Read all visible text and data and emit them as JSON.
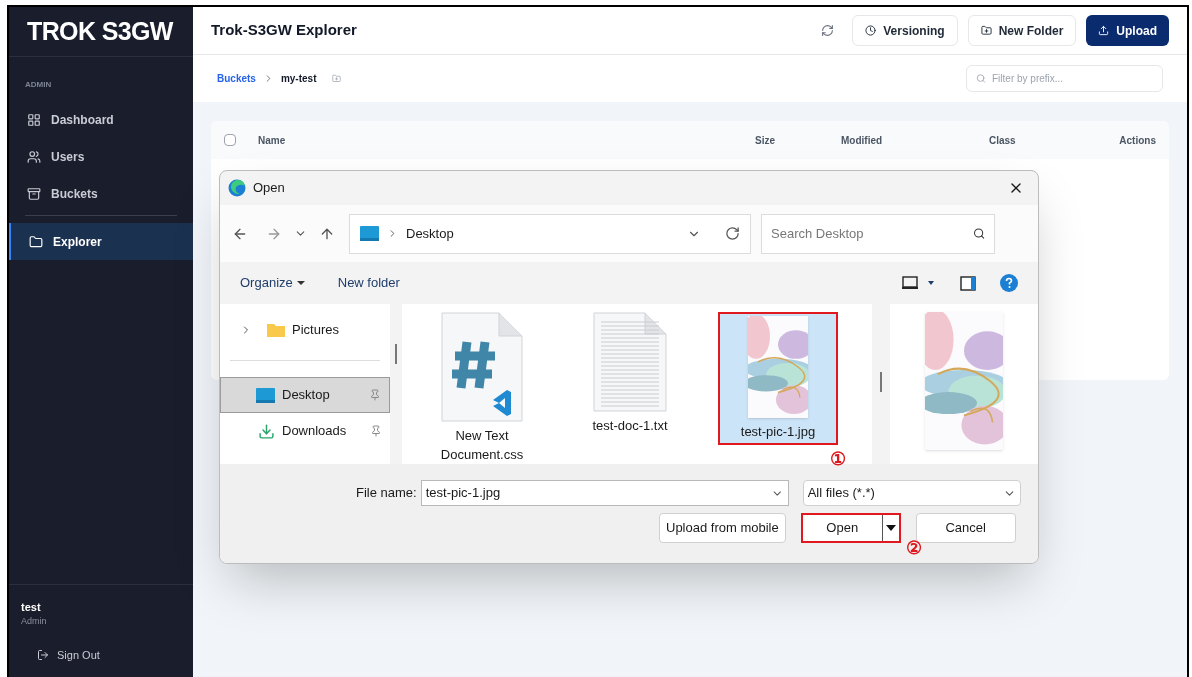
{
  "sidebar": {
    "logo": "TROK S3GW",
    "section": "ADMIN",
    "items": [
      {
        "label": "Dashboard",
        "kind": "dashboard",
        "selected": false
      },
      {
        "label": "Users",
        "kind": "users",
        "selected": false
      },
      {
        "label": "Buckets",
        "kind": "buckets",
        "selected": false
      },
      {
        "label": "Explorer",
        "kind": "explorer",
        "selected": true
      }
    ],
    "user": {
      "name": "test",
      "role": "Admin"
    },
    "sign_out": "Sign Out"
  },
  "header": {
    "title": "Trok-S3GW Explorer",
    "buttons": [
      {
        "label": "Versioning",
        "kind": "versioning"
      },
      {
        "label": "New Folder",
        "kind": "folder"
      },
      {
        "label": "Upload",
        "kind": "upload"
      }
    ]
  },
  "breadcrumb": {
    "items": [
      "Buckets",
      "my-test"
    ]
  },
  "filter": {
    "placeholder": "Filter by prefix..."
  },
  "table": {
    "select_all": {
      "checked": false
    },
    "columns": [
      "Name",
      "Size",
      "Modified",
      "Class",
      "Actions"
    ]
  },
  "dialog": {
    "title": "Open",
    "path": "Desktop",
    "search": {
      "placeholder": "Search Desktop"
    },
    "toolbar": {
      "organize": "Organize",
      "new_folder": "New folder"
    },
    "nav": [
      {
        "label": "Pictures",
        "kind": "pictures",
        "selected": false,
        "pinned": false
      },
      {
        "label": "Desktop",
        "kind": "desktop",
        "selected": true,
        "pinned": true
      },
      {
        "label": "Downloads",
        "kind": "downloads",
        "selected": false,
        "pinned": true
      }
    ],
    "files": [
      {
        "name": "New Text Document.css",
        "kind": "css",
        "selected": false
      },
      {
        "name": "test-doc-1.txt",
        "kind": "txt",
        "selected": false
      },
      {
        "name": "test-pic-1.jpg",
        "selected": true
      }
    ],
    "file_name_label": "File name:",
    "file_name": "test-pic-1.jpg",
    "file_type": "All files (*.*)",
    "buttons": {
      "mobile": "Upload from mobile",
      "open": "Open",
      "cancel": "Cancel"
    },
    "markers": {
      "file": "①",
      "open": "②"
    }
  }
}
